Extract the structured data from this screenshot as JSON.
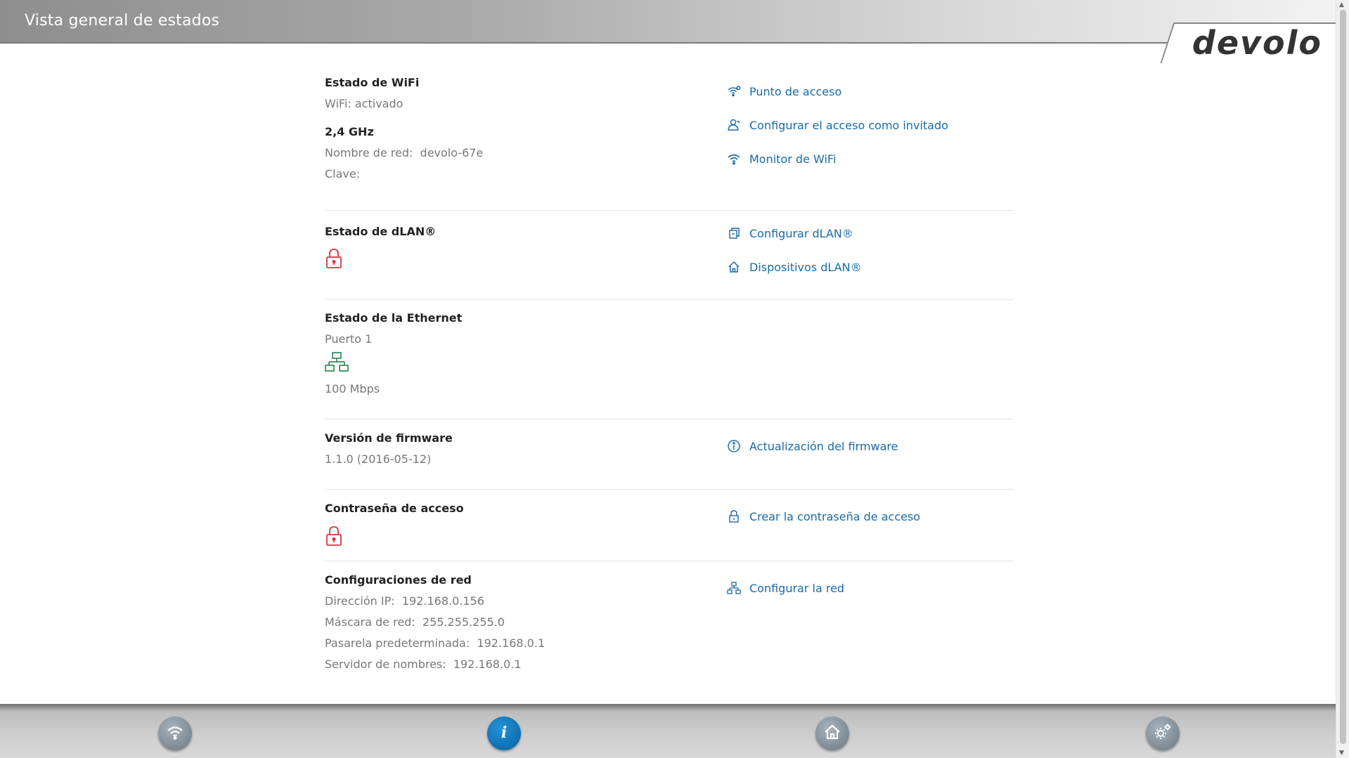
{
  "header": {
    "title": "Vista general de estados",
    "logo": "devolo"
  },
  "wifi": {
    "title": "Estado de WiFi",
    "status": "WiFi: activado",
    "band": "2,4 GHz",
    "ssid_label": "Nombre de red:",
    "ssid_value": "devolo-67e",
    "key_label": "Clave:",
    "links": {
      "access_point": "Punto de acceso",
      "guest": "Configurar el acceso como invitado",
      "monitor": "Monitor de WiFi"
    }
  },
  "dlan": {
    "title": "Estado de dLAN®",
    "lock_icon_color": "#d9363e",
    "links": {
      "configure": "Configurar dLAN®",
      "devices": "Dispositivos dLAN®"
    }
  },
  "ethernet": {
    "title": "Estado de la Ethernet",
    "port": "Puerto 1",
    "network_icon_color": "#2e8b57",
    "speed": "100 Mbps"
  },
  "firmware": {
    "title": "Versión de firmware",
    "version": "1.1.0 (2016-05-12)",
    "links": {
      "update": "Actualización del firmware"
    }
  },
  "password": {
    "title": "Contraseña de acceso",
    "lock_icon_color": "#d9363e",
    "links": {
      "create": "Crear la contraseña de acceso"
    }
  },
  "network": {
    "title": "Configuraciones de red",
    "ip_label": "Dirección IP:",
    "ip_value": "192.168.0.156",
    "mask_label": "Máscara de red:",
    "mask_value": "255.255.255.0",
    "gateway_label": "Pasarela predeterminada:",
    "gateway_value": "192.168.0.1",
    "dns_label": "Servidor de nombres:",
    "dns_value": "192.168.0.1",
    "links": {
      "configure": "Configurar la red"
    }
  },
  "colors": {
    "link": "#1a6aa8",
    "active_nav": "#0f6fb1"
  },
  "bottom_nav": [
    {
      "name": "wifi",
      "icon": "wifi-icon",
      "active": false
    },
    {
      "name": "info",
      "icon": "info-icon",
      "active": true
    },
    {
      "name": "home",
      "icon": "home-icon",
      "active": false
    },
    {
      "name": "settings",
      "icon": "gear-icon",
      "active": false
    }
  ]
}
